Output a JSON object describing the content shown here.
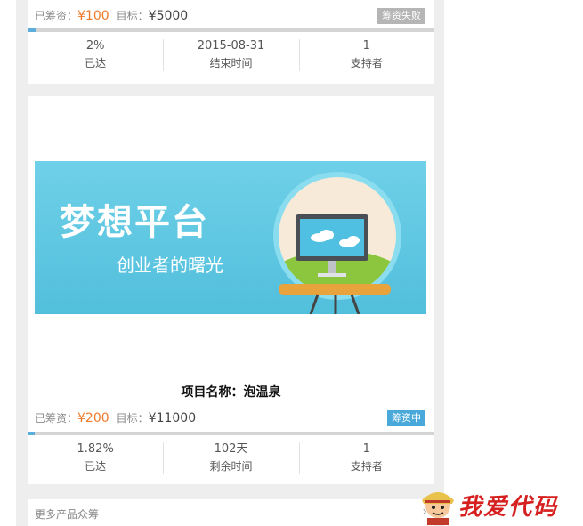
{
  "project1": {
    "raised_label": "已筹资：",
    "raised": "¥100",
    "target_label": "目标：",
    "target": "¥5000",
    "status": "筹资失败",
    "progress": 0.02,
    "stats": [
      {
        "value": "2%",
        "label": "已达"
      },
      {
        "value": "2015-08-31",
        "label": "结束时间"
      },
      {
        "value": "1",
        "label": "支持者"
      }
    ]
  },
  "project2": {
    "banner": {
      "title": "梦想平台",
      "subtitle": "创业者的曙光"
    },
    "name": "项目名称：泡温泉",
    "raised_label": "已筹资：",
    "raised": "¥200",
    "target_label": "目标：",
    "target": "¥11000",
    "status": "筹资中",
    "progress": 0.0182,
    "stats": [
      {
        "value": "1.82%",
        "label": "已达"
      },
      {
        "value": "102天",
        "label": "剩余时间"
      },
      {
        "value": "1",
        "label": "支持者"
      }
    ]
  },
  "more": {
    "label": "更多产品众筹",
    "chevron": "›"
  },
  "watermark": {
    "text": "我爱代码"
  },
  "colors": {
    "accent": "#f07a2b",
    "progress": "#5aaedc",
    "badge_active": "#4aa9db",
    "badge_fail": "#b5b5b5"
  }
}
